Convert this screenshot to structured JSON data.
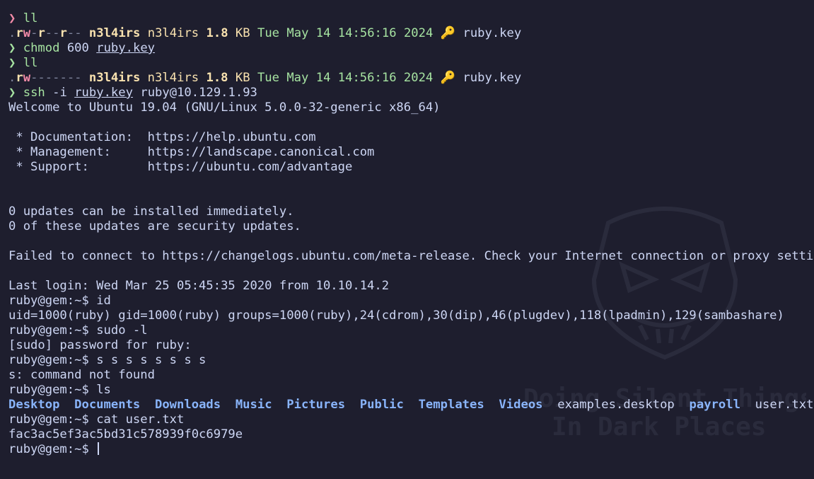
{
  "prompt_symbol": "❯",
  "colors": {
    "background": "#1e1e2e",
    "text": "#cdd6f4",
    "prompt_ok": "#a6e3a1",
    "prompt_err": "#f38ba8",
    "dir": "#89b4fa",
    "date": "#a6e3a1",
    "size": "#f9e2af"
  },
  "ls1": {
    "cmd": "ll",
    "perm": {
      "dot": ".",
      "r": "r",
      "w": "w",
      "dash1": "-",
      "r2": "r",
      "dash2": "--",
      "r3": "r",
      "dash3": "--"
    },
    "user": "n3l4irs",
    "group": "n3l4irs",
    "size": "1.8",
    "unit": "KB",
    "date": "Tue May 14 14:56:16 2024",
    "icon": "key-icon",
    "file": "ruby.key"
  },
  "chmod": {
    "cmd": "chmod",
    "args": "600",
    "file": "ruby.key"
  },
  "ls2": {
    "cmd": "ll",
    "perm": {
      "dot": ".",
      "r": "r",
      "w": "w",
      "dashes": "-------"
    },
    "user": "n3l4irs",
    "group": "n3l4irs",
    "size": "1.8",
    "unit": "KB",
    "date": "Tue May 14 14:56:16 2024",
    "icon": "key-icon",
    "file": "ruby.key"
  },
  "ssh": {
    "cmd": "ssh",
    "flag": "-i",
    "file": "ruby.key",
    "target": "ruby@10.129.1.93"
  },
  "motd": {
    "welcome": "Welcome to Ubuntu 19.04 (GNU/Linux 5.0.0-32-generic x86_64)",
    "doc": " * Documentation:  https://help.ubuntu.com",
    "mgmt": " * Management:     https://landscape.canonical.com",
    "support": " * Support:        https://ubuntu.com/advantage",
    "updates1": "0 updates can be installed immediately.",
    "updates2": "0 of these updates are security updates.",
    "failed": "Failed to connect to https://changelogs.ubuntu.com/meta-release. Check your Internet connection or proxy settings",
    "lastlogin": "Last login: Wed Mar 25 05:45:35 2020 from 10.10.14.2"
  },
  "session": {
    "prompt": "ruby@gem:~$",
    "cmd_id": "id",
    "out_id": "uid=1000(ruby) gid=1000(ruby) groups=1000(ruby),24(cdrom),30(dip),46(plugdev),118(lpadmin),129(sambashare)",
    "cmd_sudo": "sudo -l",
    "out_sudo": "[sudo] password for ruby:",
    "cmd_s": "s s s s s s s s",
    "out_s": "s: command not found",
    "cmd_ls": "ls",
    "ls_items": [
      {
        "name": "Desktop",
        "type": "dir"
      },
      {
        "name": "Documents",
        "type": "dir"
      },
      {
        "name": "Downloads",
        "type": "dir"
      },
      {
        "name": "Music",
        "type": "dir"
      },
      {
        "name": "Pictures",
        "type": "dir"
      },
      {
        "name": "Public",
        "type": "dir"
      },
      {
        "name": "Templates",
        "type": "dir"
      },
      {
        "name": "Videos",
        "type": "dir"
      },
      {
        "name": "examples.desktop",
        "type": "file"
      },
      {
        "name": "payroll",
        "type": "dir"
      },
      {
        "name": "user.txt",
        "type": "file"
      }
    ],
    "cmd_cat": "cat user.txt",
    "out_cat": "fac3ac5ef3ac5bd31c578939f0c6979e"
  },
  "watermark": {
    "line1": "Doing Silent Things",
    "line2": "In Dark Places",
    "icon": "mask-icon"
  }
}
